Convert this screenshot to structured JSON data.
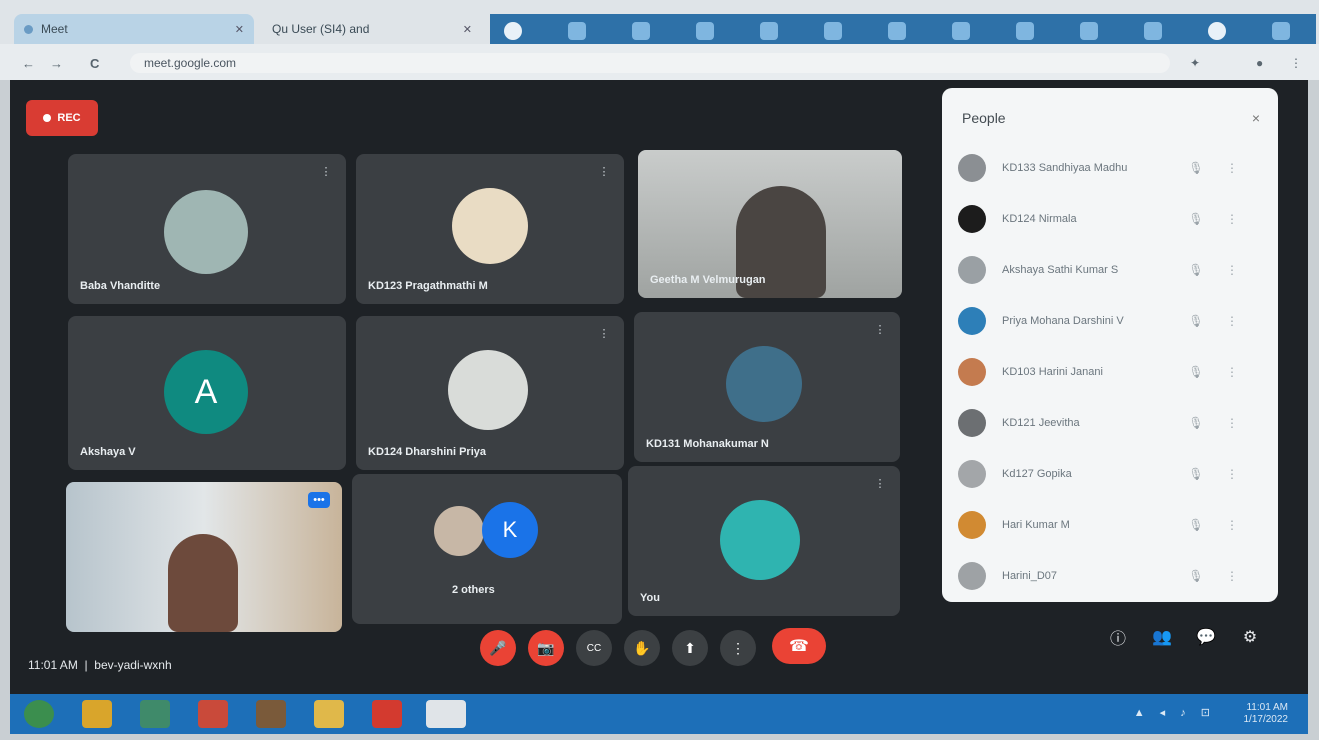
{
  "browser": {
    "tabs": [
      {
        "label": "Meet",
        "active": true
      },
      {
        "label": "Qu User (SI4) and",
        "active": false
      }
    ],
    "url": "meet.google.com",
    "nav": {
      "back": "←",
      "forward": "→",
      "reload": "C"
    },
    "strip_icon_count": 13
  },
  "meet": {
    "rec_label": "REC",
    "tiles": [
      {
        "name": "Baba Vhanditte",
        "kind": "photo",
        "color": "#9fb6b3"
      },
      {
        "name": "KD123 Pragathmathi M",
        "kind": "photo",
        "color": "#e9dcc4"
      },
      {
        "name": "Geetha M Velmurugan",
        "kind": "video",
        "color": "#8d8f8a"
      },
      {
        "name": "Akshaya V",
        "kind": "letter",
        "letter": "A",
        "color": "#0f8a80"
      },
      {
        "name": "KD124 Dharshini Priya",
        "kind": "photo",
        "color": "#d9dcd9"
      },
      {
        "name": "KD131 Mohanakumar N",
        "kind": "photo",
        "color": "#3f6f8a"
      },
      {
        "name": "",
        "kind": "video",
        "color": "#b7c4cc"
      },
      {
        "name": "2 others",
        "kind": "pair",
        "letter": "K",
        "color": "#1a73e8"
      },
      {
        "name": "You",
        "kind": "photo",
        "color": "#2fb4b0"
      }
    ],
    "time_label": "11:01 AM",
    "meeting_code": "bev-yadi-wxnh",
    "controls": {
      "mic": "🎤",
      "cam": "📷",
      "cc": "CC",
      "hand": "✋",
      "present": "⬆",
      "more": "⋮",
      "leave": "☎"
    },
    "right_icons": {
      "info": "ⓘ",
      "people": "👥",
      "chat": "💬",
      "activities": "⚙"
    }
  },
  "people_panel": {
    "title": "People",
    "close": "×",
    "participants": [
      {
        "name": "KD133 Sandhiyaa Madhu",
        "color": "#8b8f93"
      },
      {
        "name": "KD124 Nirmala",
        "color": "#1c1c1c"
      },
      {
        "name": "Akshaya Sathi Kumar S",
        "color": "#9aa0a4"
      },
      {
        "name": "Priya Mohana Darshini V",
        "color": "#2d7fb8"
      },
      {
        "name": "KD103 Harini Janani",
        "color": "#c47b4f"
      },
      {
        "name": "KD121 Jeevitha",
        "color": "#6c6f72"
      },
      {
        "name": "Kd127 Gopika",
        "color": "#a3a6a9"
      },
      {
        "name": "Hari Kumar M",
        "color": "#d18a32"
      },
      {
        "name": "Harini_D07",
        "color": "#9ea2a5"
      }
    ]
  },
  "taskbar": {
    "apps": [
      {
        "name": "start",
        "color": "#3b8e4e"
      },
      {
        "name": "chrome",
        "color": "#d9a52b"
      },
      {
        "name": "maps",
        "color": "#3f8a6a"
      },
      {
        "name": "media",
        "color": "#c94a3a"
      },
      {
        "name": "calc",
        "color": "#7a5a3a"
      },
      {
        "name": "explorer",
        "color": "#e0b84a"
      },
      {
        "name": "pdf",
        "color": "#d33a2f"
      },
      {
        "name": "chrome-active",
        "color": "#e0e4e8"
      }
    ],
    "clock_time": "11:01 AM",
    "clock_date": "1/17/2022",
    "tray": "▲ ◂ ♪ ⊡"
  }
}
